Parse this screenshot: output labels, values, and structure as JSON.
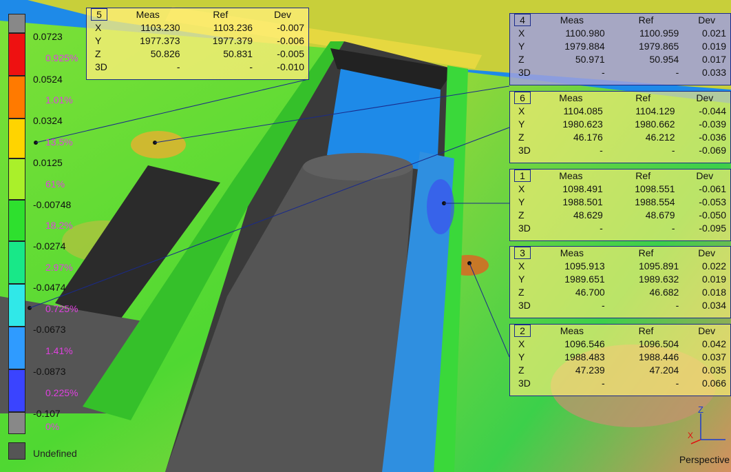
{
  "legend": {
    "ticks": [
      "0.0723",
      "0.0524",
      "0.0324",
      "0.0125",
      "-0.00748",
      "-0.0274",
      "-0.0474",
      "-0.0673",
      "-0.0873",
      "-0.107"
    ],
    "percents": [
      "0.925%",
      "1.01%",
      "13.5%",
      "61%",
      "18.2%",
      "2.97%",
      "0.725%",
      "1.41%",
      "0.225%",
      "0%"
    ],
    "colors": [
      "#888888",
      "#ee1111",
      "#ff7a00",
      "#ffd400",
      "#ffff33",
      "#aaf02a",
      "#2ee02e",
      "#18e888",
      "#30e8e8",
      "#2f9bff",
      "#3a44ff",
      "#888888"
    ],
    "undefined_label": "Undefined"
  },
  "callouts": [
    {
      "id": "5",
      "headers": [
        "Meas",
        "Ref",
        "Dev"
      ],
      "rows": [
        [
          "X",
          "1103.230",
          "1103.236",
          "-0.007"
        ],
        [
          "Y",
          "1977.373",
          "1977.379",
          "-0.006"
        ],
        [
          "Z",
          "50.826",
          "50.831",
          "-0.005"
        ],
        [
          "3D",
          "-",
          "-",
          "-0.010"
        ]
      ],
      "color": "rgba(255,238,120,0.78)"
    },
    {
      "id": "4",
      "headers": [
        "Meas",
        "Ref",
        "Dev"
      ],
      "rows": [
        [
          "X",
          "1100.980",
          "1100.959",
          "0.021"
        ],
        [
          "Y",
          "1979.884",
          "1979.865",
          "0.019"
        ],
        [
          "Z",
          "50.971",
          "50.954",
          "0.017"
        ],
        [
          "3D",
          "-",
          "-",
          "0.033"
        ]
      ],
      "color": "rgba(160,160,220,0.85)"
    },
    {
      "id": "6",
      "headers": [
        "Meas",
        "Ref",
        "Dev"
      ],
      "rows": [
        [
          "X",
          "1104.085",
          "1104.129",
          "-0.044"
        ],
        [
          "Y",
          "1980.623",
          "1980.662",
          "-0.039"
        ],
        [
          "Z",
          "46.176",
          "46.212",
          "-0.036"
        ],
        [
          "3D",
          "-",
          "-",
          "-0.069"
        ]
      ],
      "color": "rgba(255,238,120,0.65)"
    },
    {
      "id": "1",
      "headers": [
        "Meas",
        "Ref",
        "Dev"
      ],
      "rows": [
        [
          "X",
          "1098.491",
          "1098.551",
          "-0.061"
        ],
        [
          "Y",
          "1988.501",
          "1988.554",
          "-0.053"
        ],
        [
          "Z",
          "48.629",
          "48.679",
          "-0.050"
        ],
        [
          "3D",
          "-",
          "-",
          "-0.095"
        ]
      ],
      "color": "rgba(255,238,120,0.65)"
    },
    {
      "id": "3",
      "headers": [
        "Meas",
        "Ref",
        "Dev"
      ],
      "rows": [
        [
          "X",
          "1095.913",
          "1095.891",
          "0.022"
        ],
        [
          "Y",
          "1989.651",
          "1989.632",
          "0.019"
        ],
        [
          "Z",
          "46.700",
          "46.682",
          "0.018"
        ],
        [
          "3D",
          "-",
          "-",
          "0.034"
        ]
      ],
      "color": "rgba(255,238,120,0.65)"
    },
    {
      "id": "2",
      "headers": [
        "Meas",
        "Ref",
        "Dev"
      ],
      "rows": [
        [
          "X",
          "1096.546",
          "1096.504",
          "0.042"
        ],
        [
          "Y",
          "1988.483",
          "1988.446",
          "0.037"
        ],
        [
          "Z",
          "47.239",
          "47.204",
          "0.035"
        ],
        [
          "3D",
          "-",
          "-",
          "0.066"
        ]
      ],
      "color": "rgba(255,238,120,0.65)"
    }
  ],
  "view": {
    "mode_label": "Perspective",
    "axis_z": "Z",
    "axis_x": "X"
  }
}
